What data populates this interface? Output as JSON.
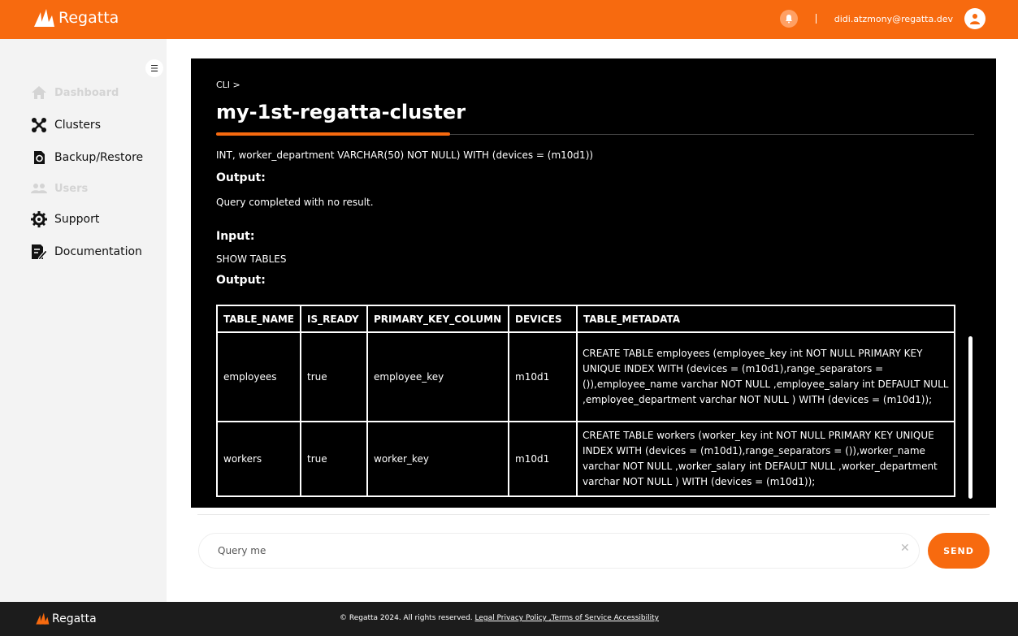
{
  "header": {
    "brand": "Regatta",
    "user_email": "didi.atzmony@regatta.dev"
  },
  "sidebar": {
    "items": [
      {
        "label": "Dashboard",
        "icon": "home-icon",
        "enabled": false
      },
      {
        "label": "Clusters",
        "icon": "clusters-icon",
        "enabled": true
      },
      {
        "label": "Backup/Restore",
        "icon": "backup-icon",
        "enabled": true
      },
      {
        "label": "Users",
        "icon": "users-icon",
        "enabled": false
      },
      {
        "label": "Support",
        "icon": "support-icon",
        "enabled": true
      },
      {
        "label": "Documentation",
        "icon": "documentation-icon",
        "enabled": true
      }
    ]
  },
  "main": {
    "breadcrumb": "CLI >",
    "cluster_name": "my-1st-regatta-cluster",
    "log": {
      "prev_input_tail": "INT, worker_department VARCHAR(50) NOT NULL) WITH (devices = (m10d1))",
      "output_label_1": "Output:",
      "output_1": "Query completed with no result.",
      "input_label": "Input:",
      "input_2": "SHOW TABLES",
      "output_label_2": "Output:"
    },
    "table": {
      "columns": [
        "TABLE_NAME",
        "IS_READY",
        "PRIMARY_KEY_COLUMN",
        "DEVICES",
        "TABLE_METADATA"
      ],
      "rows": [
        [
          "employees",
          "true",
          "employee_key",
          "m10d1",
          "CREATE TABLE employees (employee_key int NOT NULL PRIMARY KEY UNIQUE INDEX WITH (devices = (m10d1),range_separators = ()),employee_name varchar NOT NULL ,employee_salary int DEFAULT NULL ,employee_department varchar NOT NULL ) WITH (devices = (m10d1));"
        ],
        [
          "workers",
          "true",
          "worker_key",
          "m10d1",
          "CREATE TABLE workers (worker_key int NOT NULL PRIMARY KEY UNIQUE INDEX WITH (devices = (m10d1),range_separators = ()),worker_name varchar NOT NULL ,worker_salary int DEFAULT NULL ,worker_department varchar NOT NULL ) WITH (devices = (m10d1));"
        ]
      ]
    }
  },
  "query": {
    "placeholder": "Query me",
    "send_label": "SEND"
  },
  "footer": {
    "brand": "Regatta",
    "copyright": "© Regatta 2024. All rights reserved.",
    "links": "Legal Privacy Policy ,Terms of Service Accessibility"
  },
  "colors": {
    "accent": "#f76a0f",
    "panel": "#000000",
    "footer": "#1c1c1c"
  }
}
